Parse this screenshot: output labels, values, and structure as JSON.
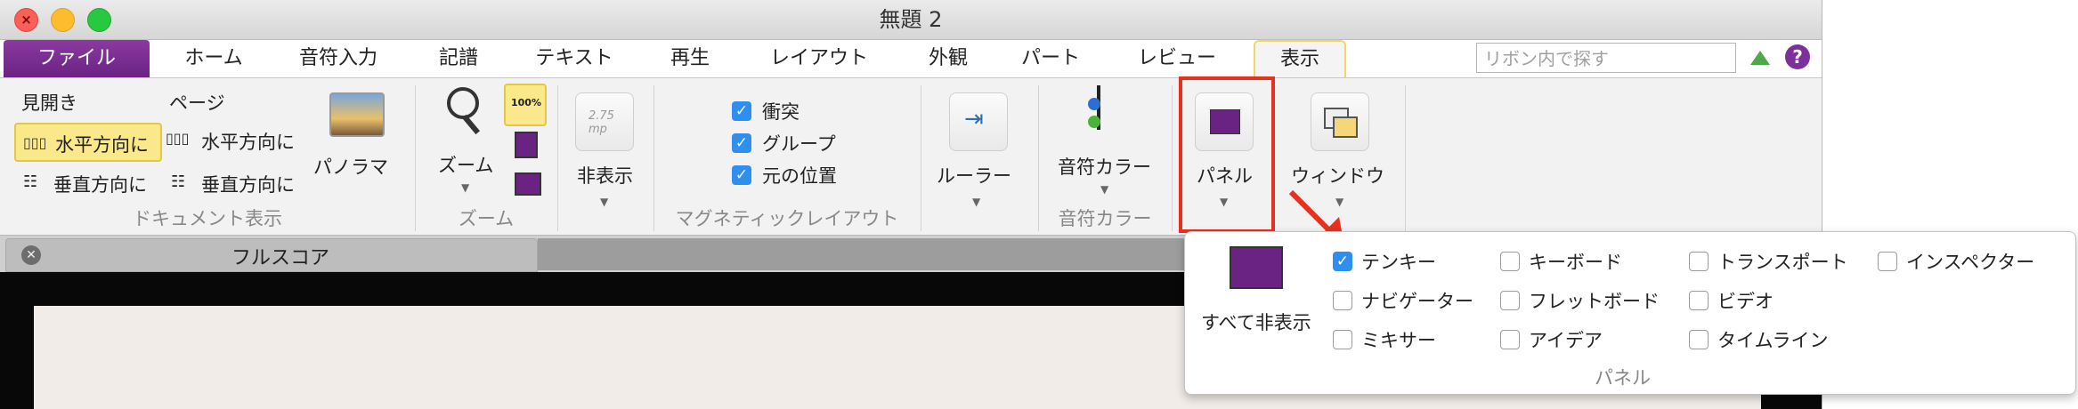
{
  "window": {
    "title": "無題 2"
  },
  "tabs": [
    "ファイル",
    "ホーム",
    "音符入力",
    "記譜",
    "テキスト",
    "再生",
    "レイアウト",
    "外観",
    "パート",
    "レビュー",
    "表示"
  ],
  "search": {
    "placeholder": "リボン内で探す",
    "help": "?"
  },
  "ribbon": {
    "doc_view": {
      "spread": "見開き",
      "page": "ページ",
      "horiz1": "水平方向に",
      "horiz2": "水平方向に",
      "vert1": "垂直方向に",
      "vert2": "垂直方向に",
      "panorama": "パノラマ",
      "label": "ドキュメント表示"
    },
    "zoom": {
      "zoom": "ズーム",
      "label": "ズーム"
    },
    "hide": {
      "label": "非表示",
      "icon_text": "2.75 mp"
    },
    "magnetic": {
      "items": [
        "衝突",
        "グループ",
        "元の位置"
      ],
      "label": "マグネティックレイアウト"
    },
    "ruler": {
      "label": "ルーラー"
    },
    "note_color": {
      "button": "音符カラー",
      "label": "音符カラー"
    },
    "panel": {
      "label": "パネル"
    },
    "window_btn": {
      "label": "ウィンドウ"
    },
    "zoom_icon_text": "100%"
  },
  "score": {
    "tab": "フルスコア"
  },
  "popup": {
    "hide_all": "すべて非表示",
    "footer": "パネル",
    "checks": [
      {
        "label": "テンキー",
        "checked": true
      },
      {
        "label": "キーボード",
        "checked": false
      },
      {
        "label": "トランスポート",
        "checked": false
      },
      {
        "label": "インスペクター",
        "checked": false
      },
      {
        "label": "ナビゲーター",
        "checked": false
      },
      {
        "label": "フレットボード",
        "checked": false
      },
      {
        "label": "ビデオ",
        "checked": false
      },
      {
        "label": "ミキサー",
        "checked": false
      },
      {
        "label": "アイデア",
        "checked": false
      },
      {
        "label": "タイムライン",
        "checked": false
      }
    ]
  },
  "colors": {
    "purple": "#6a2383",
    "highlight": "#f0d66a",
    "check_blue": "#2f8ff0",
    "annotation_red": "#e5321f"
  }
}
